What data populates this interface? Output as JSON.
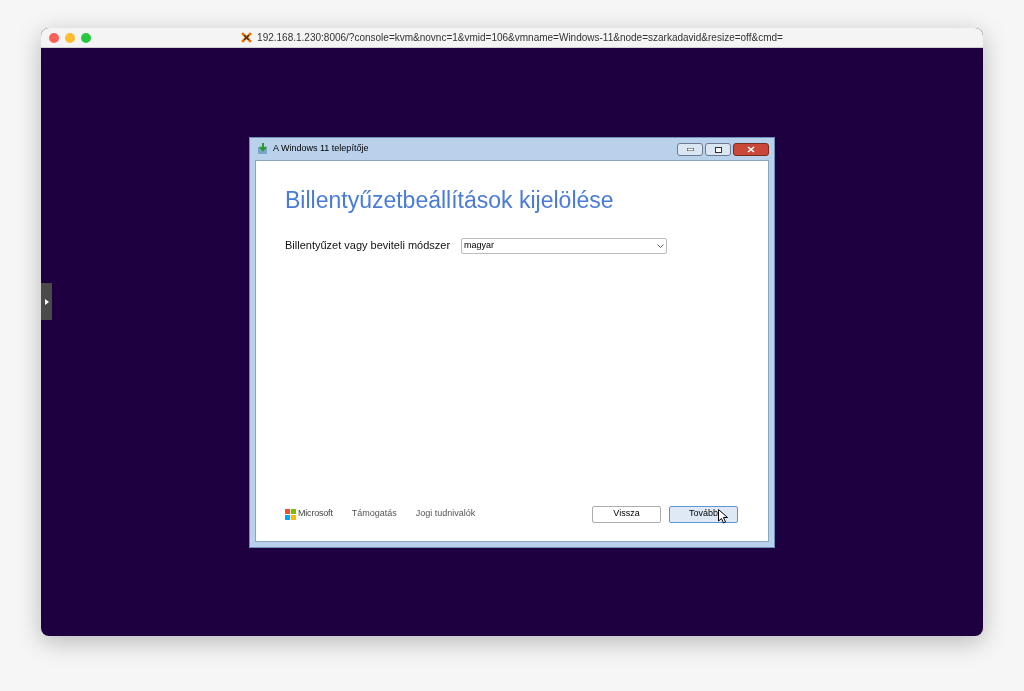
{
  "browser": {
    "address": "192.168.1.230:8006/?console=kvm&novnc=1&vmid=106&vmname=Windows-11&node=szarkadavid&resize=off&cmd="
  },
  "dialog": {
    "title": "A Windows 11 telepítője",
    "heading": "Billentyűzetbeállítások kijelölése",
    "field": {
      "label": "Billentyűzet vagy beviteli módszer",
      "value": "magyar"
    },
    "footer": {
      "brand": "Microsoft",
      "links": [
        "Támogatás",
        "Jogi tudnivalók"
      ]
    },
    "buttons": [
      {
        "label": "Vissza",
        "focused": false
      },
      {
        "label": "Tovább",
        "focused": true
      }
    ]
  }
}
